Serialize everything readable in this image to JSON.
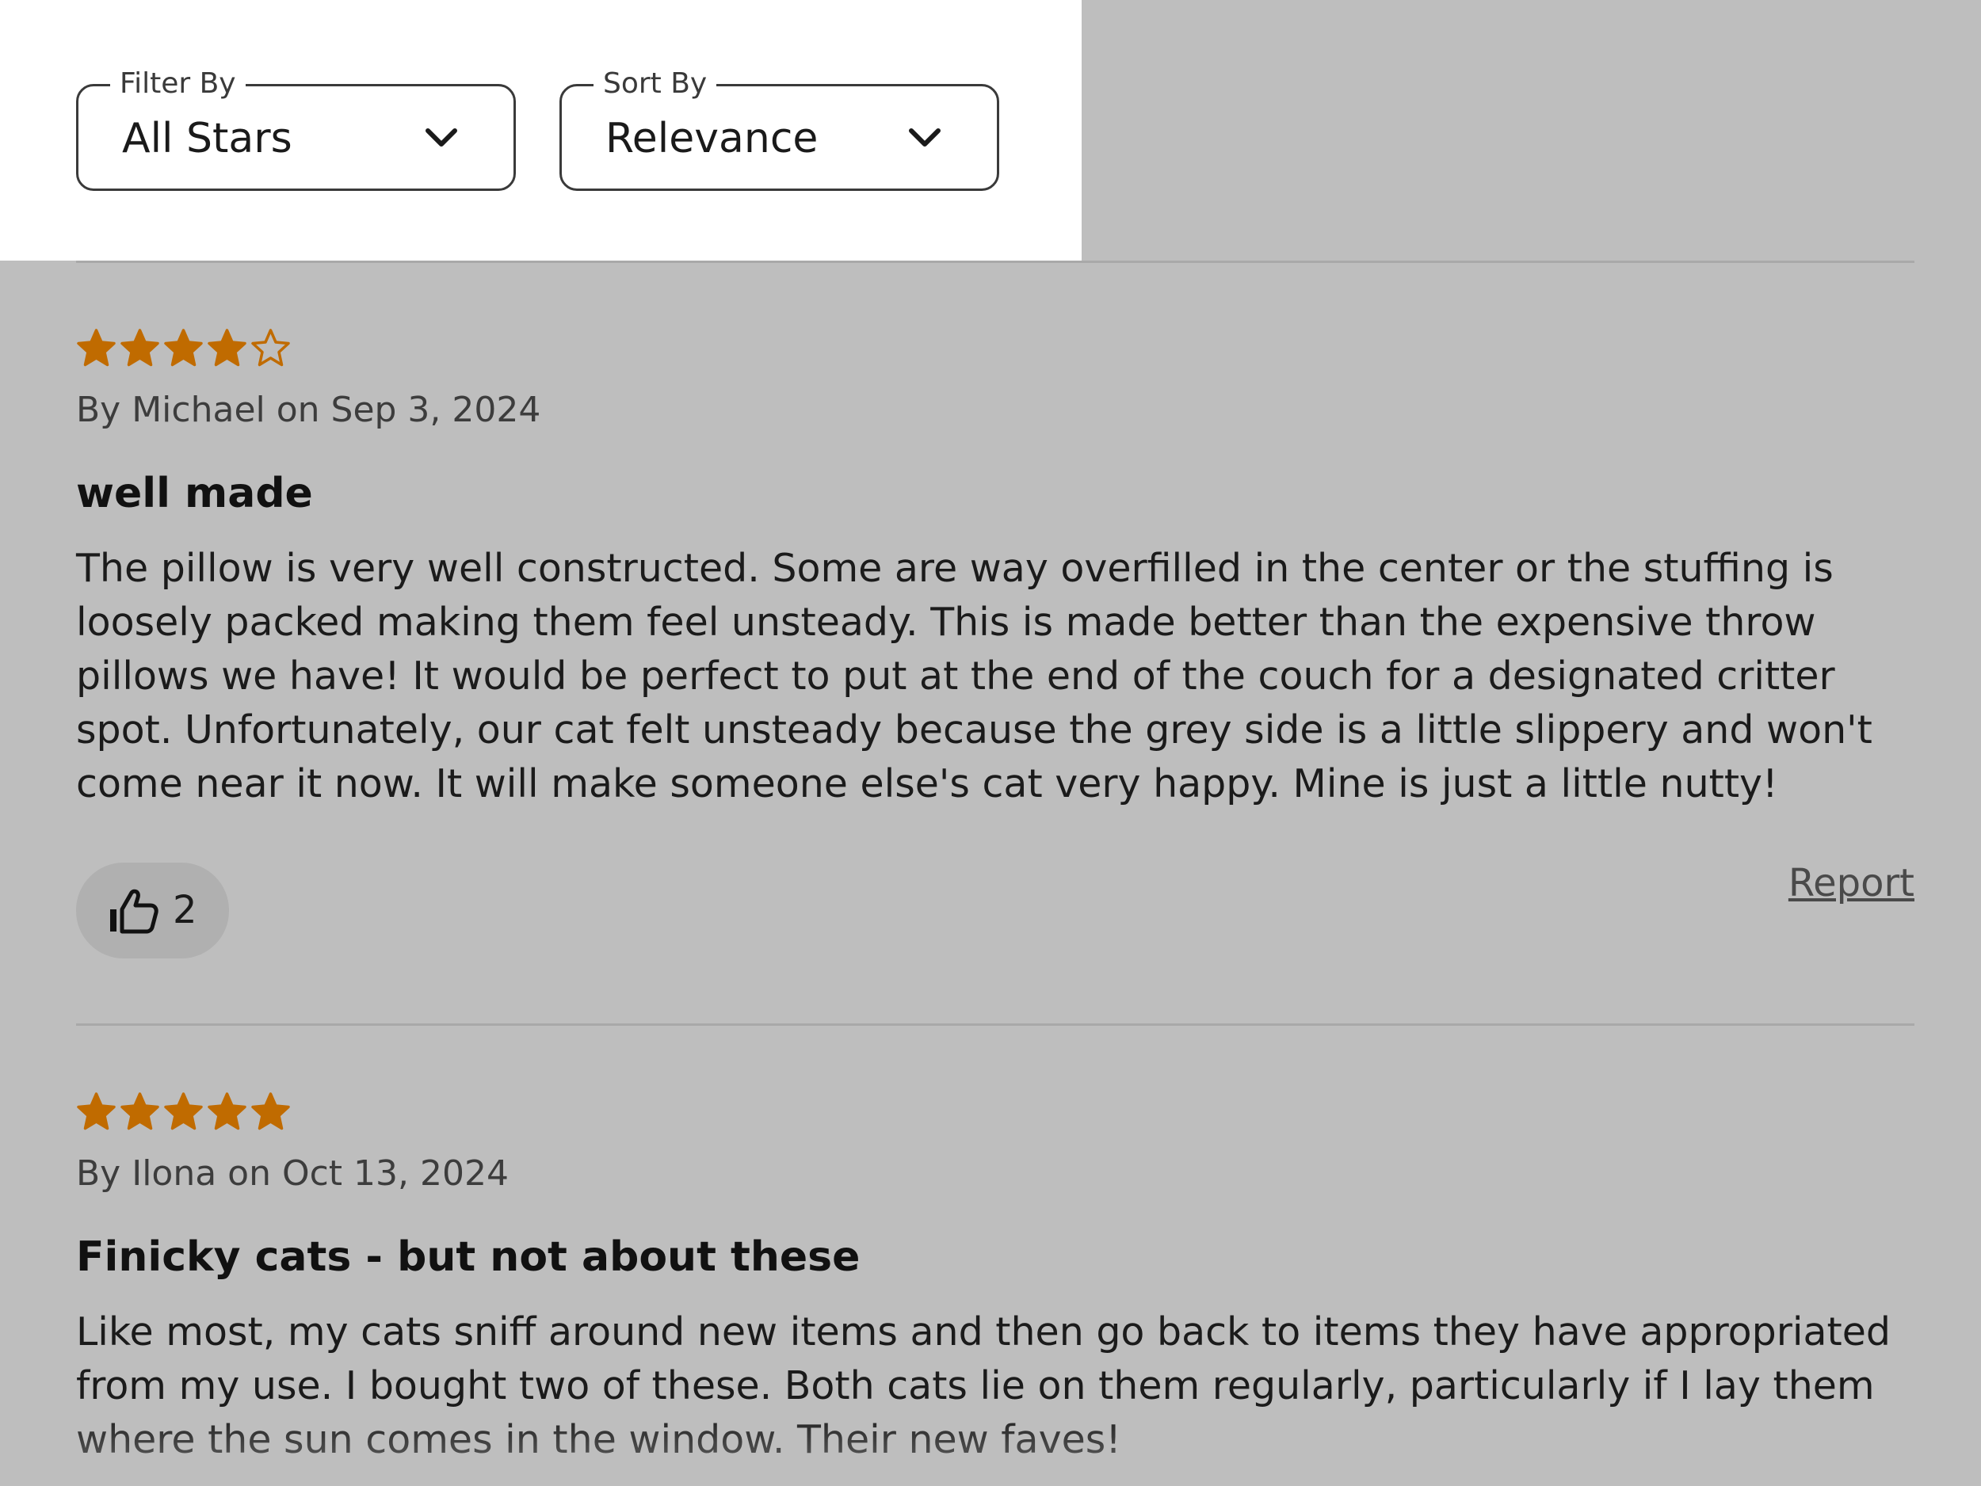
{
  "filters": {
    "filter_by": {
      "legend": "Filter By",
      "value": "All Stars"
    },
    "sort_by": {
      "legend": "Sort By",
      "value": "Relevance"
    }
  },
  "colors": {
    "star": "#c06b00",
    "overlay": "#bebebe"
  },
  "reviews": [
    {
      "rating": 4,
      "max_rating": 5,
      "byline": "By Michael on Sep 3, 2024",
      "title": "well made",
      "body": "The pillow is very well constructed. Some are way overfilled in the center or the stuffing is loosely packed making them feel unsteady. This is made better than the expensive throw pillows we have! It would be perfect to put at the end of the couch for a designated critter spot. Unfortunately, our cat felt unsteady because the grey side is a little slippery and won't come near it now. It will make someone else's cat very happy. Mine is just a little nutty!",
      "helpful_count": "2",
      "report_label": "Report"
    },
    {
      "rating": 5,
      "max_rating": 5,
      "byline": "By Ilona on Oct 13, 2024",
      "title": "Finicky cats - but not about these",
      "body": "Like most, my cats sniff around new items and then go back to items they have appropriated from my use. I bought two of these. Both cats lie on them regularly, particularly if I lay them where the sun comes in the window. Their new faves!"
    }
  ]
}
